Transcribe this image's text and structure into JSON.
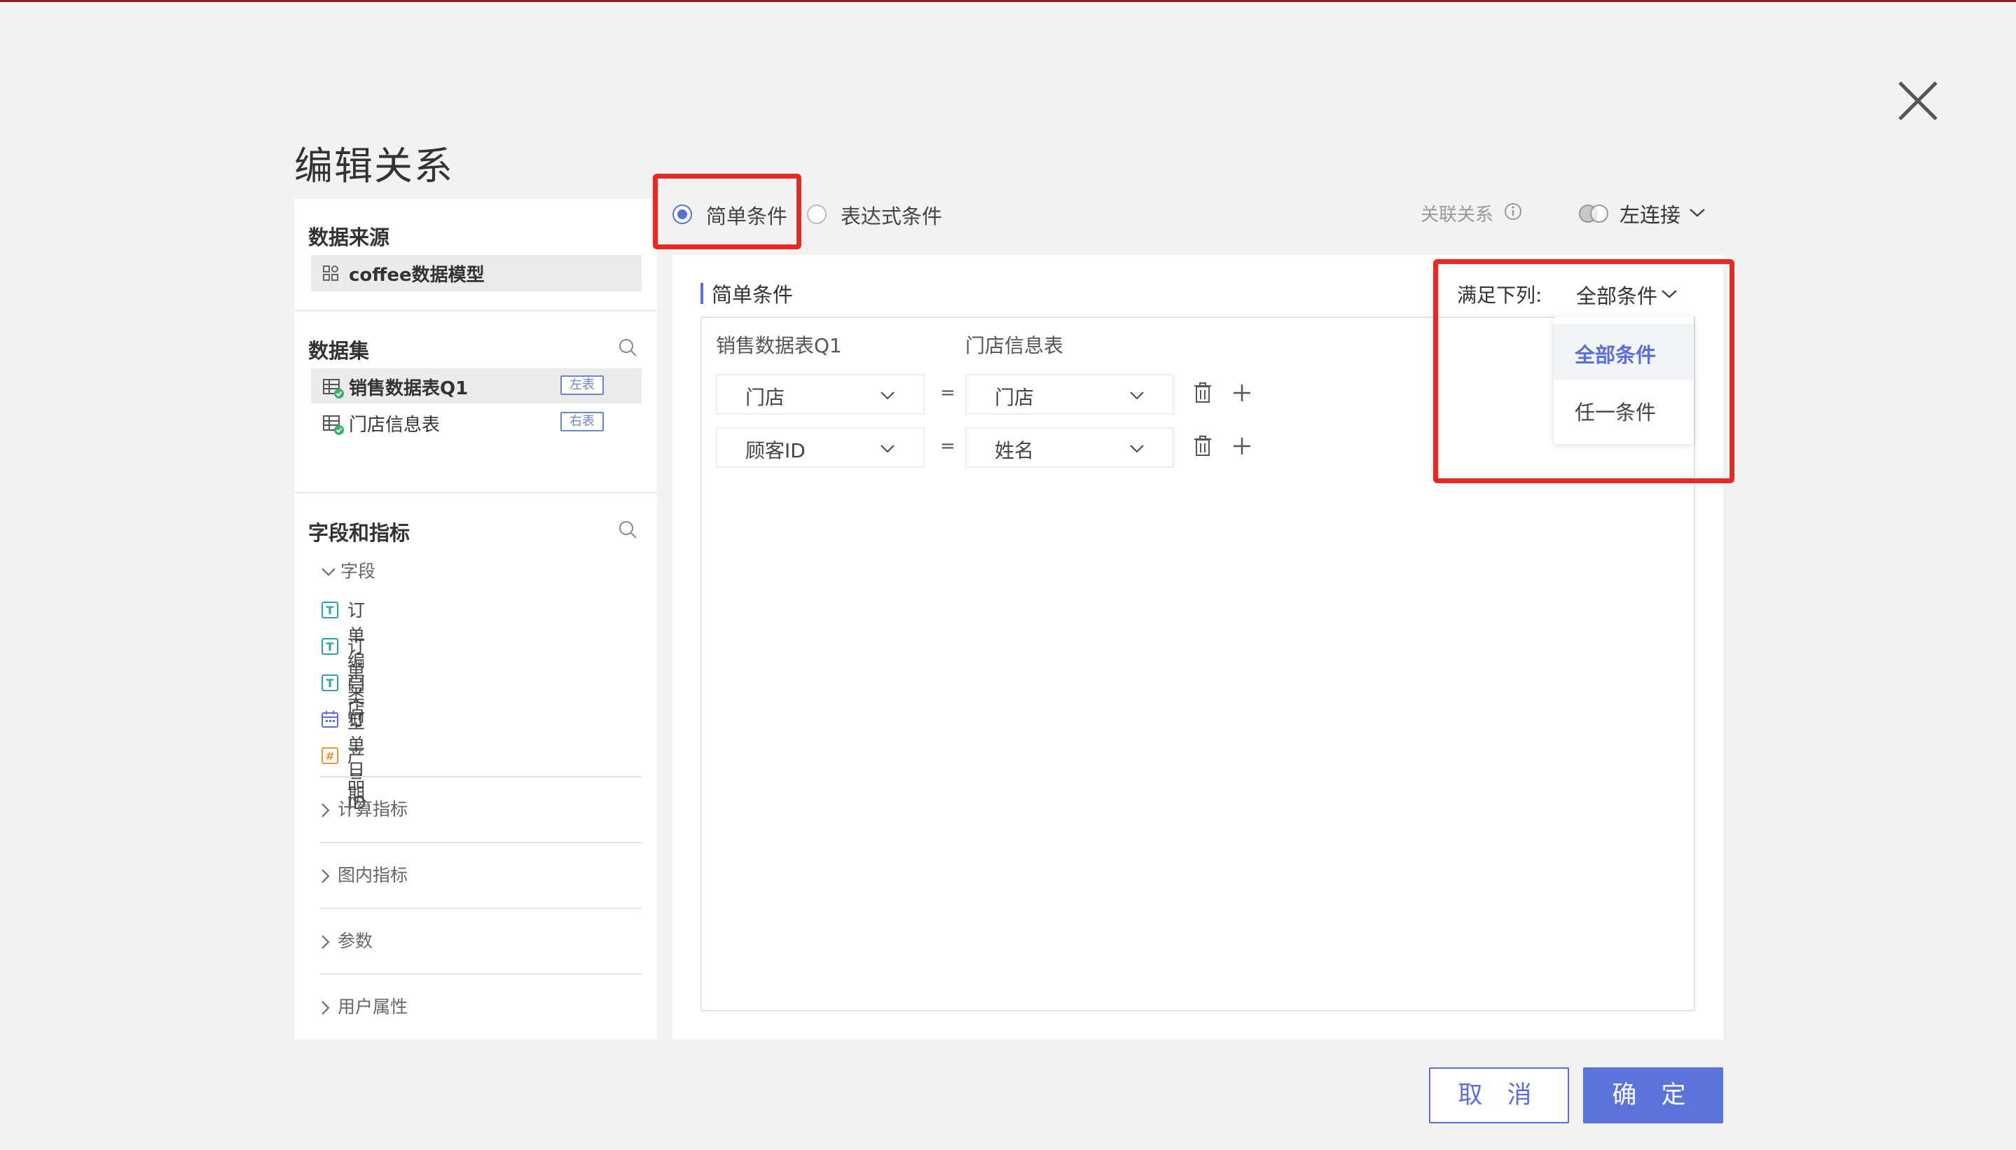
{
  "dialog": {
    "title": "编辑关系"
  },
  "left_panel": {
    "data_source": {
      "title": "数据来源",
      "name": "coffee数据模型"
    },
    "datasets": {
      "title": "数据集",
      "items": [
        {
          "name": "销售数据表Q1",
          "tag": "左表",
          "selected": true
        },
        {
          "name": "门店信息表",
          "tag": "右表",
          "selected": false
        }
      ]
    },
    "fields": {
      "title": "字段和指标",
      "group_label": "字段",
      "items": [
        {
          "name": "订单编号",
          "type": "text"
        },
        {
          "name": "订单类型",
          "type": "text"
        },
        {
          "name": "门店",
          "type": "text"
        },
        {
          "name": "订单日期",
          "type": "date"
        },
        {
          "name": "产品ID",
          "type": "number"
        }
      ],
      "collapsed_groups": [
        "计算指标",
        "图内指标",
        "参数",
        "用户属性"
      ]
    }
  },
  "condition_mode": {
    "options": [
      "简单条件",
      "表达式条件"
    ],
    "selected": "简单条件"
  },
  "relation": {
    "label": "关联关系",
    "join_type": "左连接"
  },
  "simple_conditions": {
    "title": "简单条件",
    "left_table": "销售数据表Q1",
    "right_table": "门店信息表",
    "operator": "=",
    "rows": [
      {
        "left_field": "门店",
        "right_field": "门店"
      },
      {
        "left_field": "顾客ID",
        "right_field": "姓名"
      }
    ]
  },
  "match": {
    "label": "满足下列:",
    "value": "全部条件",
    "options": [
      "全部条件",
      "任一条件"
    ]
  },
  "footer": {
    "cancel": "取 消",
    "ok": "确 定"
  },
  "colors": {
    "accent": "#5a70d8",
    "highlight": "#e52a23"
  }
}
